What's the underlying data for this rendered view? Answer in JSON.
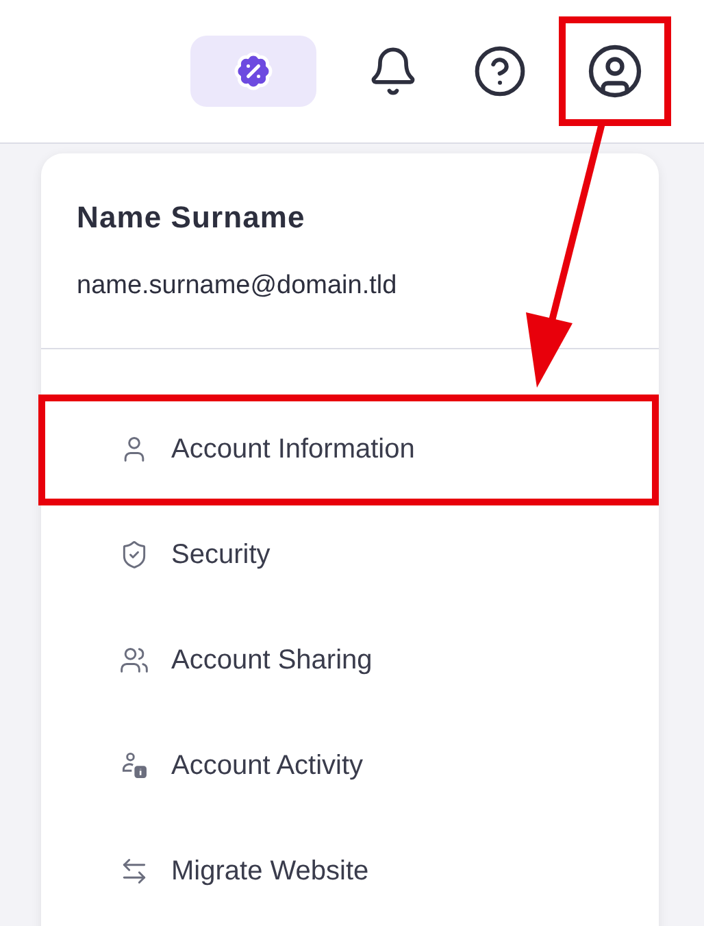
{
  "toolbar": [
    {
      "kind": "offers",
      "highlighted": false
    },
    {
      "kind": "notifications",
      "highlighted": false
    },
    {
      "kind": "help",
      "highlighted": false
    },
    {
      "kind": "profile",
      "highlighted": true
    }
  ],
  "account_menu": {
    "name": "Name Surname",
    "email": "name.surname@domain.tld",
    "items": [
      {
        "kind": "user",
        "label": "Account Information",
        "highlighted": true
      },
      {
        "kind": "security",
        "label": "Security",
        "highlighted": false
      },
      {
        "kind": "sharing",
        "label": "Account Sharing",
        "highlighted": false
      },
      {
        "kind": "activity",
        "label": "Account Activity",
        "highlighted": false
      },
      {
        "kind": "migrate",
        "label": "Migrate Website",
        "highlighted": false
      }
    ]
  }
}
